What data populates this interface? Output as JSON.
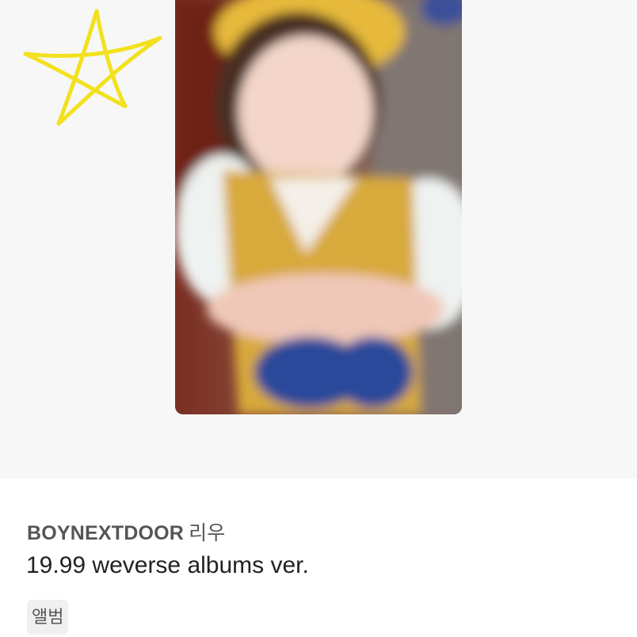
{
  "listing": {
    "artist": "BOYNEXTDOOR",
    "member": "리우",
    "subtitle": "19.99 weverse albums ver.",
    "category_tag": "앨범"
  },
  "image": {
    "subject": "blurred childhood photocard with yellow star doodle",
    "doodle_color": "#f2e11e",
    "background_color": "#f7f7f7"
  }
}
